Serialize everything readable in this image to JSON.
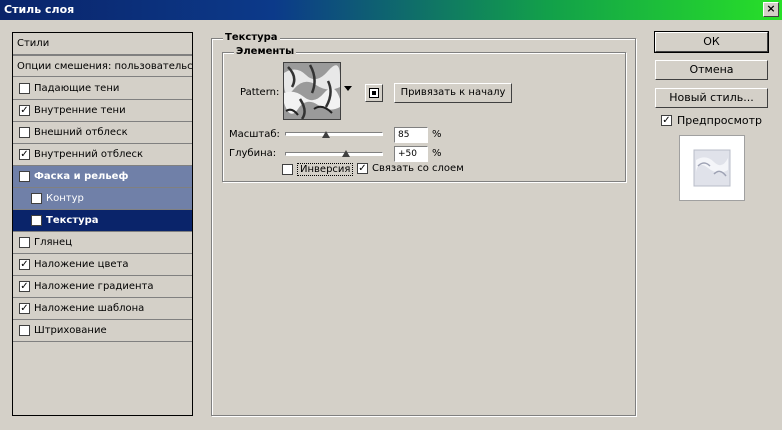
{
  "window": {
    "title": "Стиль слоя",
    "close": "×"
  },
  "styles": {
    "header": "Стили",
    "blending": "Опции смешения: пользовательские",
    "items": [
      {
        "label": "Падающие тени",
        "checked": false
      },
      {
        "label": "Внутренние тени",
        "checked": true
      },
      {
        "label": "Внешний отблеск",
        "checked": false
      },
      {
        "label": "Внутренний отблеск",
        "checked": true
      },
      {
        "label": "Фаска и рельеф",
        "checked": true
      },
      {
        "label": "Контур",
        "checked": false
      },
      {
        "label": "Текстура",
        "checked": true
      },
      {
        "label": "Глянец",
        "checked": false
      },
      {
        "label": "Наложение цвета",
        "checked": true
      },
      {
        "label": "Наложение градиента",
        "checked": true
      },
      {
        "label": "Наложение шаблона",
        "checked": true
      },
      {
        "label": "Штрихование",
        "checked": false
      }
    ]
  },
  "texture": {
    "group_title": "Текстура",
    "elements_title": "Элементы",
    "pattern_label": "Pattern:",
    "snap_button": "Привязать к началу",
    "scale_label": "Масштаб:",
    "scale_value": "85",
    "scale_fraction": 0.42,
    "depth_label": "Глубина:",
    "depth_value": "+50",
    "depth_fraction": 0.62,
    "percent": "%",
    "invert_label": "Инверсия",
    "invert_checked": false,
    "link_label": "Связать со слоем",
    "link_checked": true
  },
  "actions": {
    "ok": "ОК",
    "cancel": "Отмена",
    "new_style": "Новый стиль...",
    "preview_label": "Предпросмотр",
    "preview_checked": true
  },
  "check_mark": "✓"
}
